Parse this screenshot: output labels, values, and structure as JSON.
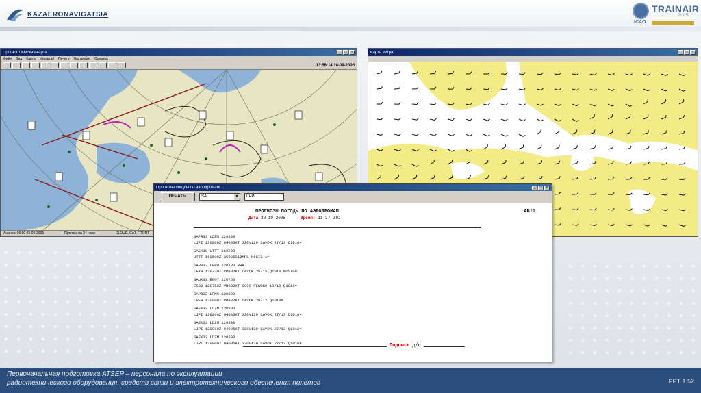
{
  "header": {
    "left_logo_text": "KAZAERONAVIGATSIA",
    "right_logo_text": "TRAINAIR",
    "right_logo_sub": "PLUS",
    "right_logo_org": "ICAO"
  },
  "map_window_1": {
    "title": "Прогностическая карта",
    "menu": [
      "Файл",
      "Вид",
      "Карта",
      "Масштаб",
      "Печать",
      "Настройки",
      "Справка"
    ],
    "clock": "13:58:14 18-09-2005",
    "status": [
      "Анализ: 06:00 09-09-2005",
      "Прогноз на 24 часа",
      "CLOUD, CAT, FRONT"
    ],
    "colors": {
      "sea": "#8fb3d6",
      "land": "#e8e5c3",
      "route": "#8a1a1a",
      "front": "#c020c0"
    }
  },
  "map_window_2": {
    "title": "Карта ветра",
    "colors": {
      "land": "#f3ec86",
      "sea": "#ffffff",
      "barb": "#111111"
    }
  },
  "report": {
    "title": "Прогнозы погоды по аэродромам",
    "print_label": "ПЕЧАТЬ",
    "combo_value": "SA",
    "field_value": "LPP/",
    "heading": "ПРОГНОЗЫ ПОГОДЫ ПО АЭРОДРОМАМ",
    "code": "AB11",
    "date_label": "Дата",
    "date_value": "30-10-2005",
    "time_label": "Время:",
    "time_value": "11:37 UTC",
    "messages": [
      "SAPR33 LDZM 120800\nLJPI 120800Z 04006KT 320V120 CAVOK 27/13 Q1016=",
      "SAEK10 UTTT 160200\nUTTT 160500Z 36005G12MPS NOSIG 1=",
      "SAPR32 LFPW 120730 RRA\nLFKB 120730Z VRB02KT CAVOK 26/15 Q1016 NOSIG=",
      "SAUK33 EGGY 120750\nEGBB 120750Z VRB02KT 9999 FEW050 13/10 Q1019=",
      "SAPO33 LPMG 120800\nLPFR 120800Z VRB02KT CAVOK 26/12 Q1019=",
      "SAEK33 LDZM 120800\nLJPI 120800Z 04006KT 320V120 CAVOK 27/13 Q1016=",
      "SAEK33 LDZM 120800\nLJPI 120800Z 04006KT 320V120 CAVOK 27/13 Q1016=",
      "SAEK33 LDZM 120800\nLJPI 120800Z 04006KT 320V120 CAVOK 27/13 Q1016="
    ],
    "sign_label": "Подпись",
    "sign_value": "д/с"
  },
  "footer": {
    "line1": "Первоначальная подготовка ATSEP – персонала по эксплуатации",
    "line2": "радиотехнического оборудования, средств связи и электротехнического обеспечения полетов",
    "page": "PPT 1.52"
  }
}
